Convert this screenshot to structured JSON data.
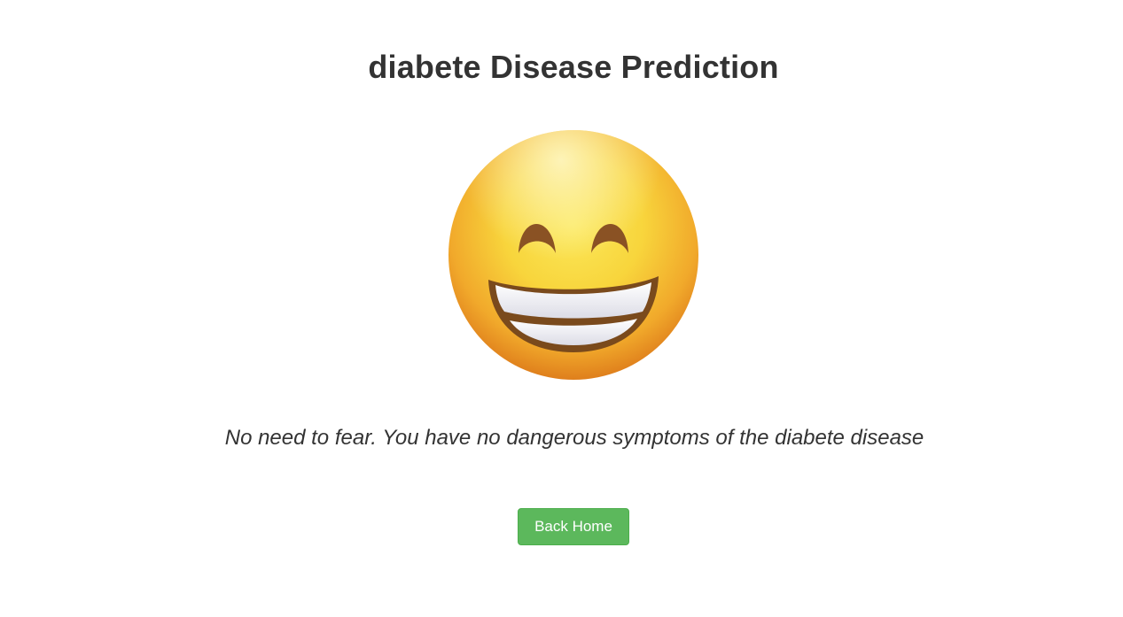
{
  "page": {
    "title": "diabete Disease Prediction",
    "result_icon": "grinning-face-emoji-icon",
    "message": "No need to fear. You have no dangerous symptoms of the diabete disease",
    "back_button_label": "Back Home"
  },
  "colors": {
    "text": "#333333",
    "button_background": "#5cb85c",
    "button_border": "#4cae4c",
    "button_text": "#ffffff",
    "emoji_face": "#f7c531",
    "emoji_outline": "#7a4a1c"
  }
}
